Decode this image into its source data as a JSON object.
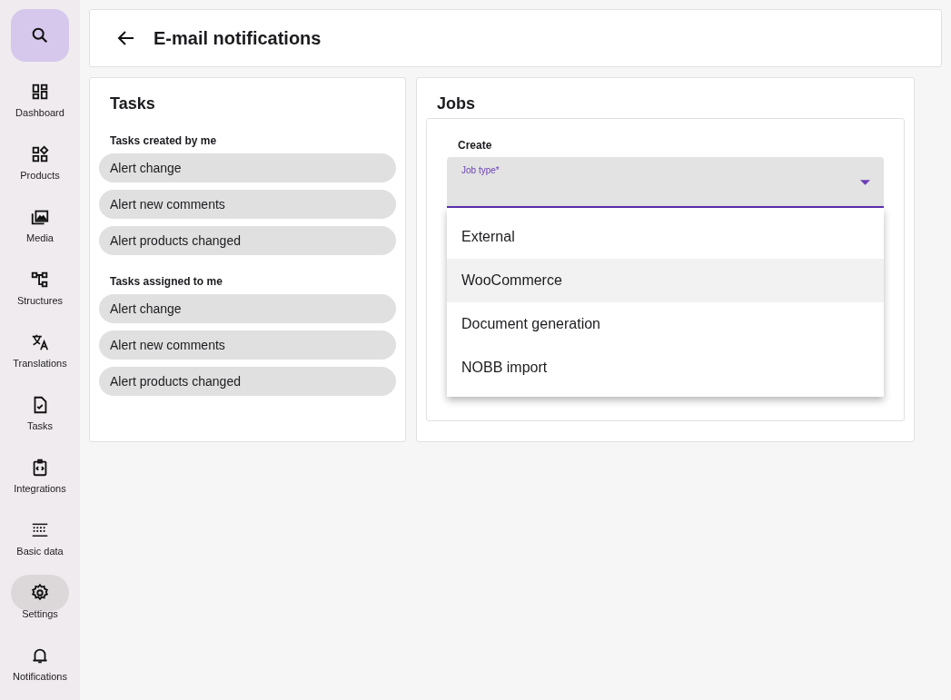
{
  "sidebar": {
    "items": [
      {
        "kind": "search",
        "selected": false
      },
      {
        "kind": "dashboard",
        "label": "Dashboard",
        "selected": false
      },
      {
        "kind": "products",
        "label": "Products",
        "selected": false
      },
      {
        "kind": "media",
        "label": "Media",
        "selected": false
      },
      {
        "kind": "structures",
        "label": "Structures",
        "selected": false
      },
      {
        "kind": "translations",
        "label": "Translations",
        "selected": false
      },
      {
        "kind": "tasks",
        "label": "Tasks",
        "selected": false
      },
      {
        "kind": "integrations",
        "label": "Integrations",
        "selected": false
      },
      {
        "kind": "basic",
        "label": "Basic data",
        "selected": false
      },
      {
        "kind": "settings",
        "label": "Settings",
        "selected": true
      },
      {
        "kind": "notifications",
        "label": "Notifications",
        "selected": false
      }
    ]
  },
  "header": {
    "title": "E-mail notifications"
  },
  "tasks": {
    "title": "Tasks",
    "groups": [
      {
        "title": "Tasks created by me",
        "items": [
          "Alert change",
          "Alert new comments",
          "Alert products changed"
        ]
      },
      {
        "title": "Tasks assigned to me",
        "items": [
          "Alert change",
          "Alert new comments",
          "Alert products changed"
        ]
      }
    ]
  },
  "jobs": {
    "title": "Jobs",
    "section": "Create",
    "field": {
      "label": "Job type*",
      "expanded": true
    },
    "options": [
      {
        "label": "External",
        "highlighted": false
      },
      {
        "label": "WooCommerce",
        "highlighted": true
      },
      {
        "label": "Document generation",
        "highlighted": false
      },
      {
        "label": "NOBB import",
        "highlighted": false
      }
    ]
  }
}
